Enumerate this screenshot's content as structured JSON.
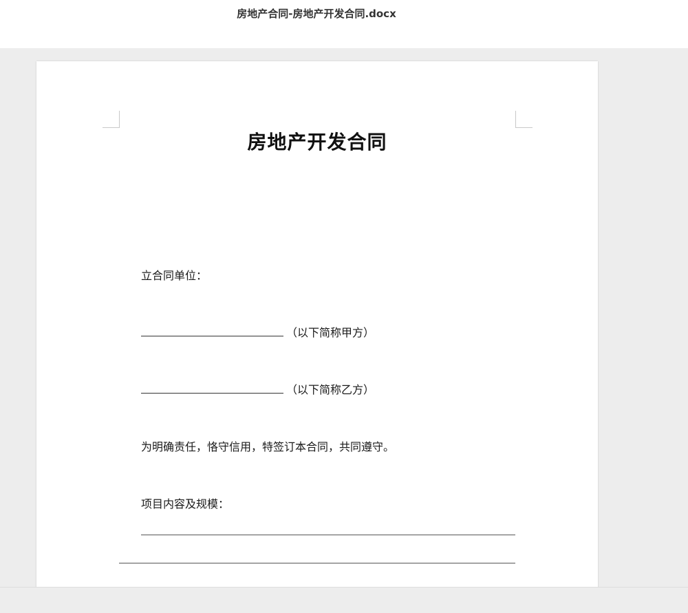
{
  "window": {
    "title": "房地产合同-房地产开发合同.docx"
  },
  "document": {
    "title": "房地产开发合同",
    "signing_parties_label": "立合同单位：",
    "party_a_suffix": "（以下简称甲方）",
    "party_b_suffix": "（以下简称乙方）",
    "preamble": "为明确责任，恪守信用，特签订本合同，共同遵守。",
    "project_label": "项目内容及规模："
  }
}
